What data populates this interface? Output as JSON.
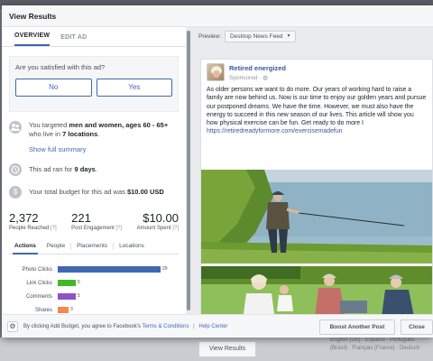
{
  "dialog": {
    "title": "View Results",
    "tabs": [
      {
        "label": "OVERVIEW",
        "active": true
      },
      {
        "label": "EDIT AD",
        "active": false
      }
    ]
  },
  "satisfaction": {
    "question": "Are you satisfied with this ad?",
    "no_label": "No",
    "yes_label": "Yes"
  },
  "targeting": {
    "prefix": "You targeted ",
    "audience": "men and women, ages 60 - 65+",
    "middle": " who live in ",
    "locations": "7 locations",
    "suffix": ".",
    "show_full_summary": "Show full summary"
  },
  "duration": {
    "prefix": "This ad ran for ",
    "days": "9 days",
    "suffix": "."
  },
  "budget": {
    "prefix": "Your total budget for this ad was ",
    "amount": "$10.00 USD"
  },
  "stats": [
    {
      "value": "2,372",
      "label": "People Reached",
      "help": "[?]"
    },
    {
      "value": "221",
      "label": "Post Engagement",
      "help": "[?]"
    },
    {
      "value": "$10.00",
      "label": "Amount Spent",
      "help": "[?]"
    }
  ],
  "results_tabs": [
    "Actions",
    "People",
    "Placements",
    "Locations"
  ],
  "chart_data": {
    "type": "bar",
    "orientation": "horizontal",
    "categories": [
      "Photo Clicks",
      "Link Clicks",
      "Comments",
      "Shares"
    ],
    "values": [
      29,
      5,
      5,
      3
    ],
    "colors": [
      "#4267b2",
      "#42b72a",
      "#8c52c6",
      "#f5874f"
    ],
    "xlim": [
      0,
      30
    ],
    "title": "",
    "xlabel": "",
    "ylabel": ""
  },
  "preview": {
    "label": "Preview:",
    "placement": "Desktop News Feed"
  },
  "post": {
    "page_name": "Retired energized",
    "sponsored": "Sponsored",
    "body": "As older persons we want to do more. Our years of working hard to raise a family are now behind us. Now is our time to enjoy our golden years and pursue our postponed dreams. We have the time. However, we must also have the energy to succeed in this new season of our lives. This article will show you how physical exercise can be fun. Get ready to do more I",
    "link": "https://retiredreadyformore.com/exercisemadefun"
  },
  "footer": {
    "text": "By clicking Add Budget, you agree to Facebook's",
    "terms": "Terms & Conditions",
    "separator": "|",
    "help": "Help Center",
    "boost_label": "Boost Another Post",
    "close_label": "Close"
  },
  "background": {
    "view_results": "View Results",
    "languages": "English (US) · Español · Português (Brasil) · Français (France) · Deutsch"
  },
  "colors": {
    "accent": "#4267b2",
    "link": "#365899"
  },
  "icons": {
    "targeting": "people-icon",
    "duration": "clock-icon",
    "budget": "dollar-icon",
    "settings": "gear-icon"
  }
}
